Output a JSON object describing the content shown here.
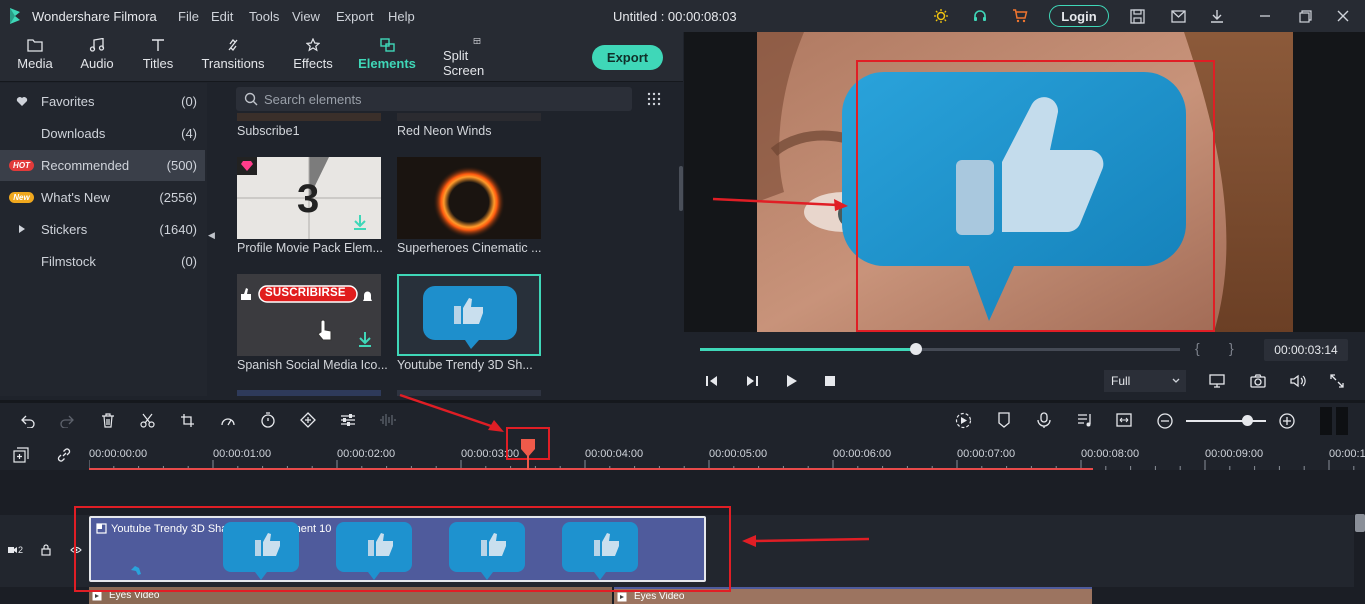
{
  "app": {
    "name": "Wondershare Filmora",
    "title": "Untitled : 00:00:08:03",
    "login": "Login"
  },
  "menu": [
    "File",
    "Edit",
    "Tools",
    "View",
    "Export",
    "Help"
  ],
  "tools": [
    {
      "label": "Media",
      "icon": "folder-icon"
    },
    {
      "label": "Audio",
      "icon": "music-note-icon"
    },
    {
      "label": "Titles",
      "icon": "text-icon"
    },
    {
      "label": "Transitions",
      "icon": "transition-icon"
    },
    {
      "label": "Effects",
      "icon": "effects-icon"
    },
    {
      "label": "Elements",
      "icon": "elements-icon",
      "active": true
    },
    {
      "label": "Split Screen",
      "icon": "split-screen-icon"
    }
  ],
  "export_label": "Export",
  "sidebar": [
    {
      "label": "Favorites",
      "count": "(0)",
      "icon": "heart-icon"
    },
    {
      "label": "Downloads",
      "count": "(4)"
    },
    {
      "label": "Recommended",
      "count": "(500)",
      "badge": "HOT",
      "selected": true
    },
    {
      "label": "What's New",
      "count": "(2556)",
      "badge": "New"
    },
    {
      "label": "Stickers",
      "count": "(1640)",
      "icon": "caret-right-icon"
    },
    {
      "label": "Filmstock",
      "count": "(0)"
    }
  ],
  "search": {
    "placeholder": "Search elements"
  },
  "elements": [
    {
      "label": "Subscribe1"
    },
    {
      "label": "Red Neon Winds"
    },
    {
      "label": "Profile Movie Pack Elem...",
      "text": "3"
    },
    {
      "label": "Superheroes Cinematic ..."
    },
    {
      "label": "Spanish Social Media Ico...",
      "text": "SUSCRIBIRSE"
    },
    {
      "label": "Youtube Trendy 3D Sh...",
      "selected": true
    }
  ],
  "player": {
    "time": "00:00:03:14",
    "progress": 0.45,
    "quality": "Full"
  },
  "ruler": [
    "00:00:00:00",
    "00:00:01:00",
    "00:00:02:00",
    "00:00:03:00",
    "00:00:04:00",
    "00:00:05:00",
    "00:00:06:00",
    "00:00:07:00",
    "00:00:08:00",
    "00:00:09:00",
    "00:00:1"
  ],
  "tracks": {
    "element_clip": "Youtube Trendy 3D Shapes Pack Element 10",
    "video_clip_1": "Eyes Video",
    "video_clip_2": "Eyes Video",
    "track_num": "2"
  },
  "colors": {
    "accent": "#3fd7b8",
    "annotation": "#e01e25",
    "clip": "#4f5b9c"
  }
}
